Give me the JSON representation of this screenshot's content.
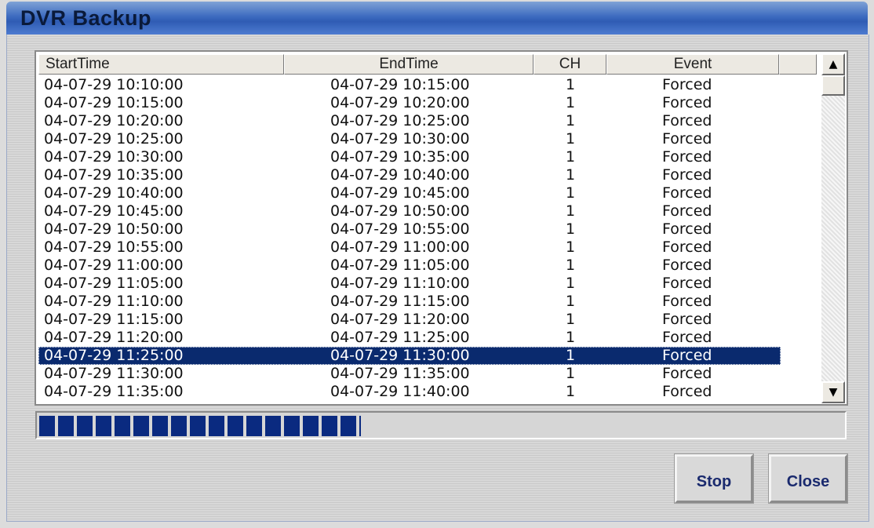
{
  "window": {
    "title": "DVR Backup"
  },
  "table": {
    "columns": [
      "StartTime",
      "EndTime",
      "CH",
      "Event"
    ],
    "rows": [
      {
        "start": "04-07-29 10:10:00",
        "end": "04-07-29 10:15:00",
        "ch": "1",
        "event": "Forced"
      },
      {
        "start": "04-07-29 10:15:00",
        "end": "04-07-29 10:20:00",
        "ch": "1",
        "event": "Forced"
      },
      {
        "start": "04-07-29 10:20:00",
        "end": "04-07-29 10:25:00",
        "ch": "1",
        "event": "Forced"
      },
      {
        "start": "04-07-29 10:25:00",
        "end": "04-07-29 10:30:00",
        "ch": "1",
        "event": "Forced"
      },
      {
        "start": "04-07-29 10:30:00",
        "end": "04-07-29 10:35:00",
        "ch": "1",
        "event": "Forced"
      },
      {
        "start": "04-07-29 10:35:00",
        "end": "04-07-29 10:40:00",
        "ch": "1",
        "event": "Forced"
      },
      {
        "start": "04-07-29 10:40:00",
        "end": "04-07-29 10:45:00",
        "ch": "1",
        "event": "Forced"
      },
      {
        "start": "04-07-29 10:45:00",
        "end": "04-07-29 10:50:00",
        "ch": "1",
        "event": "Forced"
      },
      {
        "start": "04-07-29 10:50:00",
        "end": "04-07-29 10:55:00",
        "ch": "1",
        "event": "Forced"
      },
      {
        "start": "04-07-29 10:55:00",
        "end": "04-07-29 11:00:00",
        "ch": "1",
        "event": "Forced"
      },
      {
        "start": "04-07-29 11:00:00",
        "end": "04-07-29 11:05:00",
        "ch": "1",
        "event": "Forced"
      },
      {
        "start": "04-07-29 11:05:00",
        "end": "04-07-29 11:10:00",
        "ch": "1",
        "event": "Forced"
      },
      {
        "start": "04-07-29 11:10:00",
        "end": "04-07-29 11:15:00",
        "ch": "1",
        "event": "Forced"
      },
      {
        "start": "04-07-29 11:15:00",
        "end": "04-07-29 11:20:00",
        "ch": "1",
        "event": "Forced"
      },
      {
        "start": "04-07-29 11:20:00",
        "end": "04-07-29 11:25:00",
        "ch": "1",
        "event": "Forced"
      },
      {
        "start": "04-07-29 11:25:00",
        "end": "04-07-29 11:30:00",
        "ch": "1",
        "event": "Forced",
        "selected": true
      },
      {
        "start": "04-07-29 11:30:00",
        "end": "04-07-29 11:35:00",
        "ch": "1",
        "event": "Forced"
      },
      {
        "start": "04-07-29 11:35:00",
        "end": "04-07-29 11:40:00",
        "ch": "1",
        "event": "Forced"
      }
    ]
  },
  "scrollbar": {
    "up_icon": "scroll-up-arrow-icon",
    "down_icon": "scroll-down-arrow-icon"
  },
  "progress": {
    "fraction": 0.4
  },
  "buttons": {
    "stop": "Stop",
    "close": "Close"
  },
  "colors": {
    "selection": "#0a2a6e",
    "progress": "#0a2a80",
    "title_bar": "#3d6bc0"
  }
}
